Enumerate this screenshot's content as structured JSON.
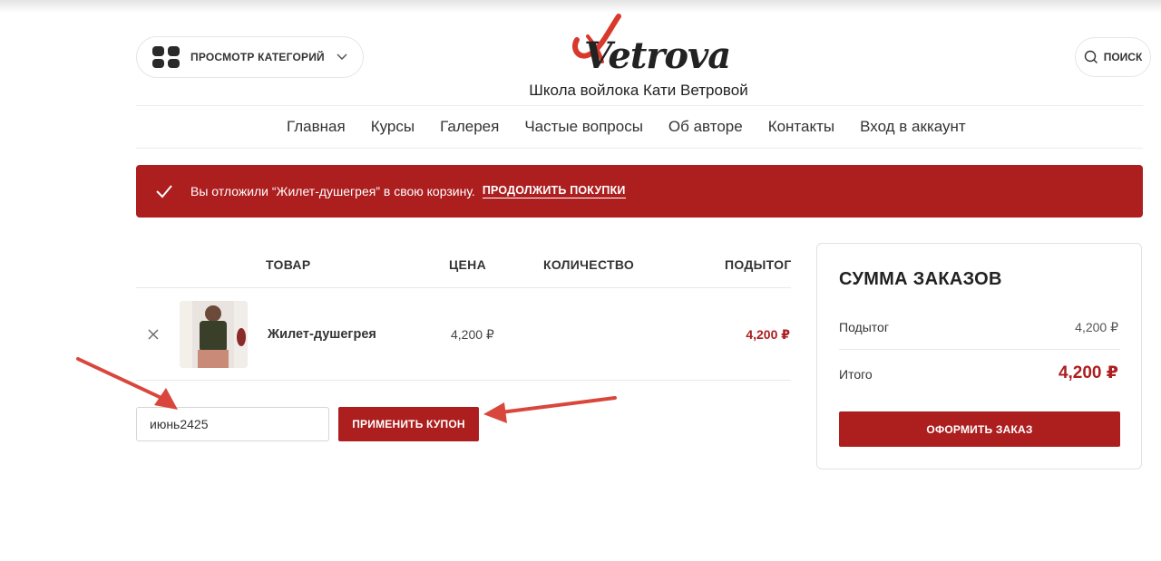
{
  "header": {
    "categories_label": "ПРОСМОТР КАТЕГОРИЙ",
    "logo_text": "Vetrova",
    "site_subtitle": "Школа войлока Кати Ветровой",
    "search_label": "ПОИСК"
  },
  "nav": {
    "items": [
      "Главная",
      "Курсы",
      "Галерея",
      "Частые вопросы",
      "Об авторе",
      "Контакты",
      "Вход в аккаунт"
    ]
  },
  "notice": {
    "text": "Вы отложили “Жилет-душегрея” в свою корзину.",
    "link": "ПРОДОЛЖИТЬ ПОКУПКИ"
  },
  "cart": {
    "headers": {
      "product": "ТОВАР",
      "price": "ЦЕНА",
      "quantity": "КОЛИЧЕСТВО",
      "subtotal": "ПОДЫТОГ"
    },
    "items": [
      {
        "name": "Жилет-душегрея",
        "price": "4,200 ₽",
        "subtotal": "4,200 ₽"
      }
    ],
    "coupon": {
      "value": "июнь2425",
      "button": "ПРИМЕНИТЬ КУПОН"
    }
  },
  "totals": {
    "title": "СУММА ЗАКАЗОВ",
    "subtotal_label": "Подытог",
    "subtotal_value": "4,200 ₽",
    "total_label": "Итого",
    "total_value": "4,200 ₽",
    "checkout_button": "ОФОРМИТЬ ЗАКАЗ"
  },
  "colors": {
    "accent": "#ad1e1f",
    "annotation_arrow": "#d9473c"
  },
  "icons": [
    "grid-icon",
    "chevron-down-icon",
    "search-icon",
    "check-icon",
    "close-icon"
  ]
}
